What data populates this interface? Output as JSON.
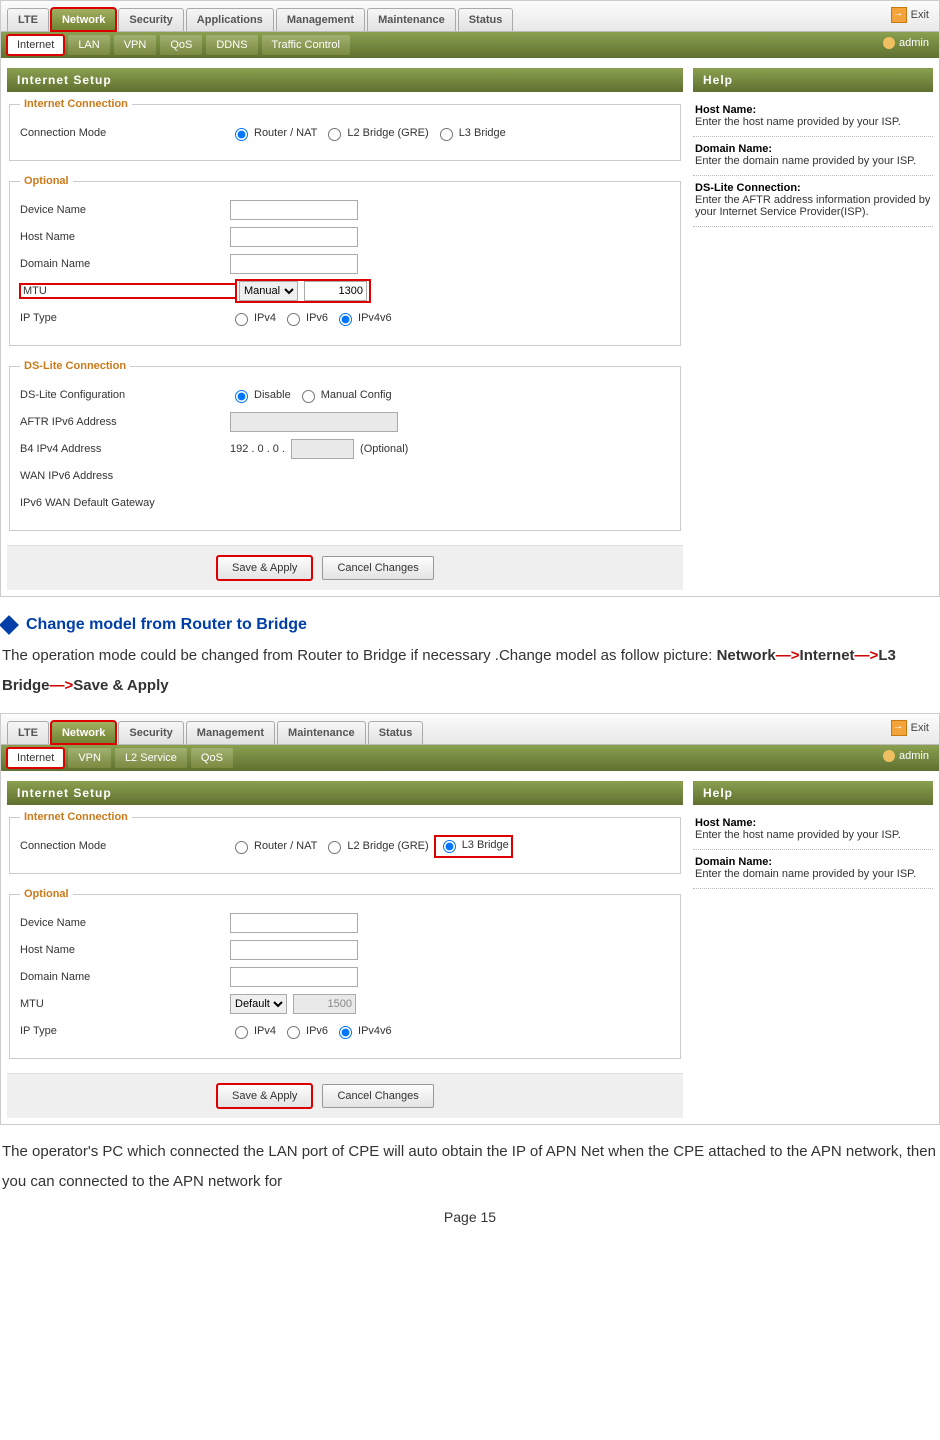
{
  "exit": "Exit",
  "user": "admin",
  "nav1": {
    "tabs": [
      "LTE",
      "Network",
      "Security",
      "Applications",
      "Management",
      "Maintenance",
      "Status"
    ],
    "active": 1
  },
  "sub1": {
    "tabs": [
      "Internet",
      "LAN",
      "VPN",
      "QoS",
      "DDNS",
      "Traffic Control"
    ],
    "active": 0
  },
  "title": "Internet Setup",
  "fs1": {
    "legend": "Internet Connection",
    "conn_mode_lbl": "Connection Mode",
    "opts": [
      "Router / NAT",
      "L2 Bridge (GRE)",
      "L3 Bridge"
    ],
    "sel": 0
  },
  "fs2": {
    "legend": "Optional",
    "rows": [
      {
        "lbl": "Device Name",
        "val": ""
      },
      {
        "lbl": "Host Name",
        "val": ""
      },
      {
        "lbl": "Domain Name",
        "val": ""
      }
    ],
    "mtu_lbl": "MTU",
    "mtu_mode": "Manual",
    "mtu_val": "1300",
    "iptype_lbl": "IP Type",
    "ip_opts": [
      "IPv4",
      "IPv6",
      "IPv4v6"
    ],
    "ip_sel": 2
  },
  "fs3": {
    "legend": "DS-Lite Connection",
    "cfg_lbl": "DS-Lite Configuration",
    "cfg_opts": [
      "Disable",
      "Manual Config"
    ],
    "cfg_sel": 0,
    "aftr_lbl": "AFTR IPv6 Address",
    "b4_lbl": "B4 IPv4 Address",
    "b4_prefix": "192 . 0 . 0 .",
    "b4_note": "(Optional)",
    "wan6_lbl": "WAN IPv6 Address",
    "gw_lbl": "IPv6 WAN Default Gateway"
  },
  "btns": {
    "save": "Save & Apply",
    "cancel": "Cancel Changes"
  },
  "help": {
    "title": "Help",
    "items": [
      {
        "h": "Host Name:",
        "t": "Enter the host name provided by your ISP."
      },
      {
        "h": "Domain Name:",
        "t": "Enter the domain name provided by your ISP."
      },
      {
        "h": "DS-Lite Connection:",
        "t": "Enter the AFTR address information provided by your Internet Service Provider(ISP)."
      }
    ]
  },
  "doc": {
    "heading": "Change model from Router to Bridge",
    "p1": "The operation mode could be changed from Router to Bridge if necessary .Change model as follow picture: ",
    "path": [
      "Network",
      "Internet",
      "L3 Bridge",
      "Save & Apply"
    ],
    "p2": "The operator's PC which connected the LAN port of CPE will auto obtain the IP of  APN Net when the CPE attached to the APN network, then you can connected to the APN network for",
    "page": "Page 15"
  },
  "nav2": {
    "tabs": [
      "LTE",
      "Network",
      "Security",
      "Management",
      "Maintenance",
      "Status"
    ],
    "active": 1
  },
  "sub2": {
    "tabs": [
      "Internet",
      "VPN",
      "L2 Service",
      "QoS"
    ],
    "active": 0
  },
  "fs1b": {
    "sel": 2
  },
  "fs2b": {
    "mtu_mode": "Default",
    "mtu_val": "1500"
  },
  "help2": {
    "items": [
      {
        "h": "Host Name:",
        "t": "Enter the host name provided by your ISP."
      },
      {
        "h": "Domain Name:",
        "t": "Enter the domain name provided by your ISP."
      }
    ]
  }
}
